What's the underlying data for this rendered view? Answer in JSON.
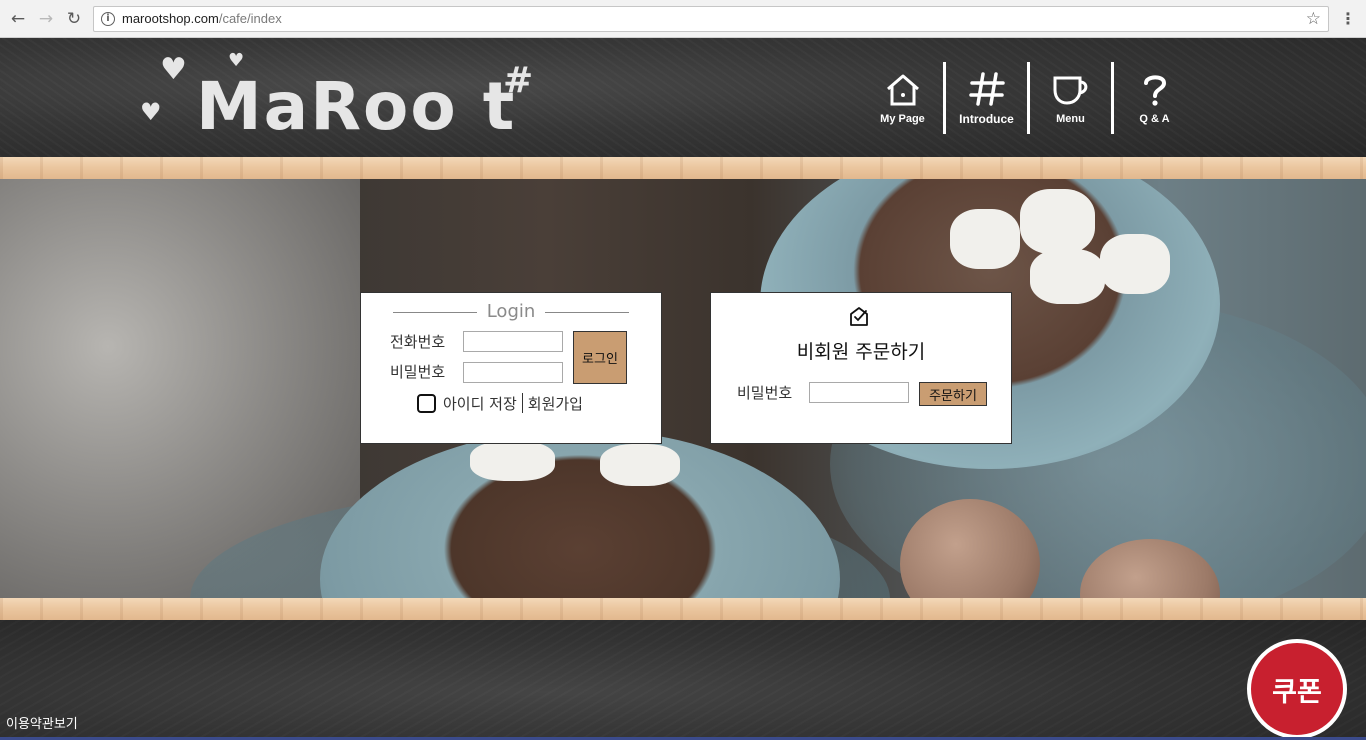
{
  "browser": {
    "url_host": "marootshop.com",
    "url_path": "/cafe/index",
    "back_icon": "←",
    "forward_icon": "→",
    "reload_icon": "↻",
    "info_icon": "i",
    "star_icon": "☆",
    "menu_icon": "⋮"
  },
  "header": {
    "logo_text": "MaRoo t",
    "logo_sharp": "#",
    "heart_glyph": "♥",
    "nav": [
      {
        "label": "My Page",
        "icon": "house-icon"
      },
      {
        "label": "Introduce",
        "icon": "hash-icon"
      },
      {
        "label": "Menu",
        "icon": "cup-icon"
      },
      {
        "label": "Q & A",
        "icon": "question-icon"
      }
    ]
  },
  "login": {
    "title": "Login",
    "phone_label": "전화번호",
    "phone_value": "",
    "password_label": "비밀번호",
    "password_value": "",
    "login_button": "로그인",
    "save_id_label": "아이디 저장",
    "signup_label": "회원가입"
  },
  "guest": {
    "title": "비회원 주문하기",
    "password_label": "비밀번호",
    "password_value": "",
    "order_button": "주문하기",
    "icon": "check-box-icon"
  },
  "footer": {
    "terms_link": "이용약관보기",
    "coupon_label": "쿠폰"
  },
  "colors": {
    "button_tan": "#c99d72",
    "coupon_red": "#c8202f",
    "chalk": "#e6e6e6"
  }
}
